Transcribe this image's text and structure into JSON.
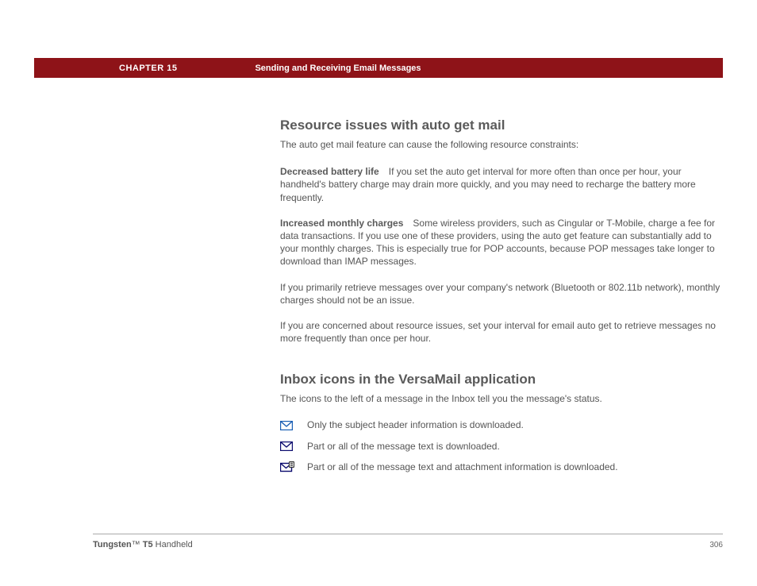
{
  "header": {
    "chapter_label": "CHAPTER 15",
    "section_label": "Sending and Receiving Email Messages"
  },
  "section1": {
    "title": "Resource issues with auto get mail",
    "lead": "The auto get mail feature can cause the following resource constraints:",
    "p1_runin": "Decreased battery life",
    "p1_body": "If you set the auto get interval for more often than once per hour, your handheld's battery charge may drain more quickly, and you may need to recharge the battery more frequently.",
    "p2_runin": "Increased monthly charges",
    "p2_body": "Some wireless providers, such as Cingular or T-Mobile, charge a fee for data transactions. If you use one of these providers, using the auto get feature can substantially add to your monthly charges. This is especially true for POP accounts, because POP messages take longer to download than IMAP messages.",
    "p3": "If you primarily retrieve messages over your company's network (Bluetooth or 802.11b network), monthly charges should not be an issue.",
    "p4": "If you are concerned about resource issues, set your interval for email auto get to retrieve messages no more frequently than once per hour."
  },
  "section2": {
    "title": "Inbox icons in the VersaMail application",
    "lead": "The icons to the left of a message in the Inbox tell you the message's status.",
    "rows": [
      {
        "icon": "envelope-open-blue",
        "text": "Only the subject header information is downloaded."
      },
      {
        "icon": "envelope-blue",
        "text": "Part or all of the message text is downloaded."
      },
      {
        "icon": "envelope-attachment",
        "text": "Part or all of the message text and attachment information is downloaded."
      }
    ]
  },
  "footer": {
    "brand": "Tungsten",
    "tm": "™",
    "model": " T5",
    "suffix": " Handheld",
    "page": "306"
  }
}
